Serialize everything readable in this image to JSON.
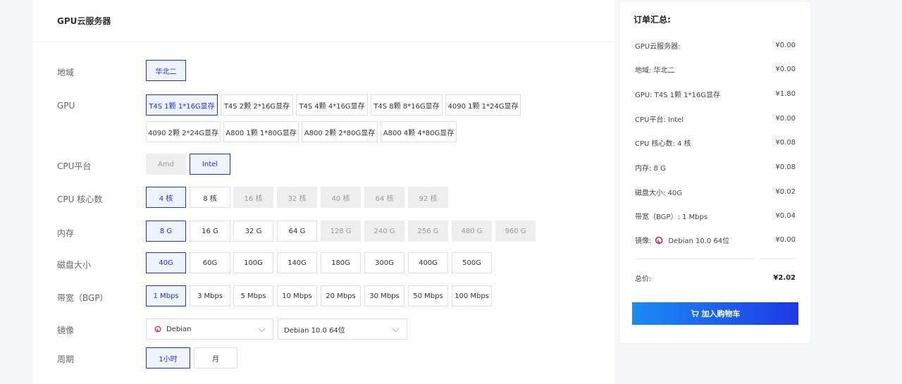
{
  "header": {
    "title": "GPU云服务器"
  },
  "region": {
    "label": "地域",
    "options": [
      "华北二"
    ],
    "selected": 0
  },
  "gpu": {
    "label": "GPU",
    "options": [
      "T4S 1颗 1*16G显存",
      "T4S 2颗 2*16G显存",
      "T4S 4颗 4*16G显存",
      "T4S 8颗 8*16G显存",
      "4090 1颗 1*24G显存",
      "4090 2颗 2*24G显存",
      "A800 1颗 1*80G显存",
      "A800 2颗 2*80G显存",
      "A800 4颗 4*80G显存"
    ],
    "selected": 0
  },
  "cpu_platform": {
    "label": "CPU平台",
    "options": [
      "Amd",
      "Intel"
    ],
    "selected": 1,
    "disabled": [
      0
    ]
  },
  "cpu_cores": {
    "label": "CPU 核心数",
    "options": [
      "4 核",
      "8 核",
      "16 核",
      "32 核",
      "40 核",
      "64 核",
      "92 核"
    ],
    "selected": 0,
    "disabled": [
      2,
      3,
      4,
      5,
      6
    ]
  },
  "memory": {
    "label": "内存",
    "options": [
      "8 G",
      "16 G",
      "32 G",
      "64 G",
      "128 G",
      "240 G",
      "256 G",
      "480 G",
      "960 G"
    ],
    "selected": 0,
    "disabled": [
      4,
      5,
      6,
      7,
      8
    ]
  },
  "disk": {
    "label": "磁盘大小",
    "options": [
      "40G",
      "60G",
      "100G",
      "140G",
      "180G",
      "300G",
      "400G",
      "500G"
    ],
    "selected": 0
  },
  "bandwidth": {
    "label": "带宽（BGP）",
    "options": [
      "1 Mbps",
      "3 Mbps",
      "5 Mbps",
      "10 Mbps",
      "20 Mbps",
      "30 Mbps",
      "50 Mbps",
      "100 Mbps"
    ],
    "selected": 0
  },
  "image": {
    "label": "镜像",
    "os_value": "Debian",
    "version_value": "Debian 10.0 64位"
  },
  "period": {
    "label": "周期",
    "options": [
      "1小时",
      "月"
    ],
    "selected": 0
  },
  "summary": {
    "title": "订单汇总:",
    "rows": [
      {
        "label": "GPU云服务器:",
        "price": "¥0.00"
      },
      {
        "label": "地域: 华北二",
        "price": "¥0.00"
      },
      {
        "label": "GPU: T4S 1颗 1*16G显存",
        "price": "¥1.80"
      },
      {
        "label": "CPU平台: Intel",
        "price": "¥0.00"
      },
      {
        "label": "CPU 核心数: 4 核",
        "price": "¥0.08"
      },
      {
        "label": "内存: 8 G",
        "price": "¥0.08"
      },
      {
        "label": "磁盘大小: 40G",
        "price": "¥0.02"
      },
      {
        "label": "带宽（BGP）: 1 Mbps",
        "price": "¥0.04"
      }
    ],
    "image_row": {
      "label": "镜像:",
      "value": "Debian 10.0 64位",
      "price": "¥0.00"
    },
    "total": {
      "label": "总价:",
      "price": "¥2.02"
    },
    "cart_button": "加入购物车"
  },
  "colors": {
    "accent": "#2130e0",
    "button_start": "#1a8cf5",
    "button_end": "#1f39e6",
    "debian_red": "#d70a53"
  },
  "icons": {
    "debian": "debian-swirl-icon",
    "cart": "cart-icon",
    "dropdown": "chevron-down-icon"
  }
}
